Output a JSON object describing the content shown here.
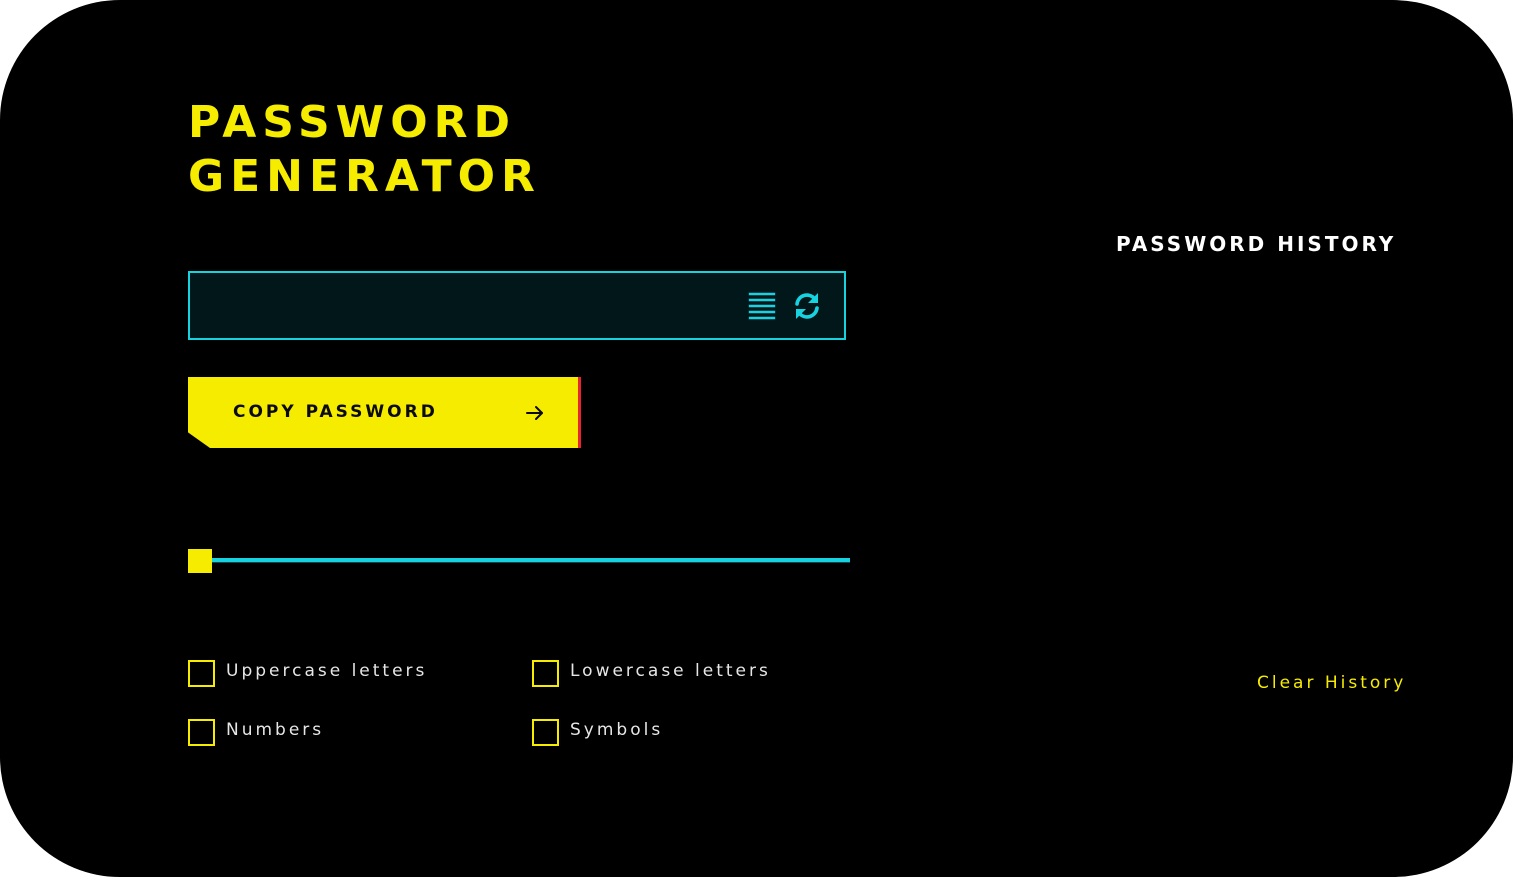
{
  "app": {
    "title_line1": "PASSWORD",
    "title_line2": "GENERATOR"
  },
  "password": {
    "value": "",
    "placeholder": ""
  },
  "icons": {
    "list": "list-icon",
    "refresh": "refresh-icon",
    "arrow": "arrow-right-icon"
  },
  "copy_button": {
    "label": "COPY PASSWORD"
  },
  "length_slider": {
    "value_fraction": 0.0
  },
  "options": [
    {
      "label": "Uppercase letters",
      "checked": false
    },
    {
      "label": "Lowercase letters",
      "checked": false
    },
    {
      "label": "Numbers",
      "checked": false
    },
    {
      "label": "Symbols",
      "checked": false
    }
  ],
  "history": {
    "title": "PASSWORD HISTORY",
    "items": [],
    "clear_label": "Clear History"
  },
  "colors": {
    "background": "#000000",
    "accent_yellow": "#f6ec00",
    "accent_cyan": "#17d3e0",
    "accent_red": "#e8252d",
    "text_light": "#e6e6e6"
  }
}
